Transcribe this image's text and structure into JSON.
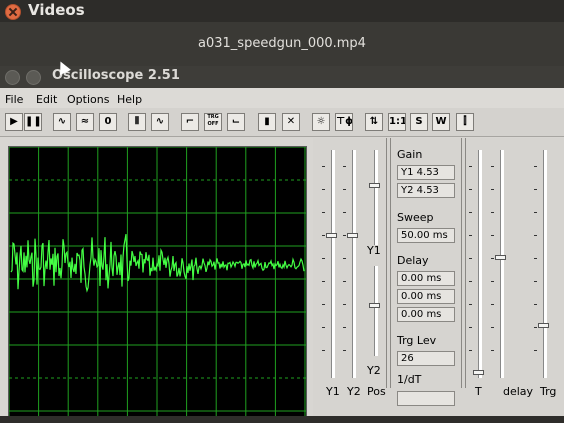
{
  "player": {
    "title": "Videos",
    "filename": "a031_speedgun_000.mp4"
  },
  "scope_window": {
    "title": "Oscilloscope 2.51",
    "menu": [
      "File",
      "Edit",
      "Options",
      "Help"
    ]
  },
  "toolbar_buttons": [
    {
      "name": "play-button",
      "glyph": "▶"
    },
    {
      "name": "pause-button",
      "glyph": "❚❚"
    },
    {
      "name": "sine-wave-button",
      "glyph": "∿"
    },
    {
      "name": "dual-wave-button",
      "glyph": "≈"
    },
    {
      "name": "xy-mode-button",
      "glyph": "0"
    },
    {
      "name": "pulse-wave-button",
      "glyph": "⫴"
    },
    {
      "name": "sine-sweep-button",
      "glyph": "∿"
    },
    {
      "name": "trigger-rise-button",
      "glyph": "⌐"
    },
    {
      "name": "trigger-off-button",
      "glyph": "TRG OFF"
    },
    {
      "name": "trigger-fall-button",
      "glyph": "⌙"
    },
    {
      "name": "spectrum-button",
      "glyph": "▮"
    },
    {
      "name": "cursor-button",
      "glyph": "✕"
    },
    {
      "name": "brightness-button",
      "glyph": "☼"
    },
    {
      "name": "phase-button",
      "glyph": "⊤ϕ"
    },
    {
      "name": "arrows-button",
      "glyph": "⇅"
    },
    {
      "name": "one-to-one-button",
      "glyph": "1:1"
    },
    {
      "name": "s-button",
      "glyph": "S"
    },
    {
      "name": "w-button",
      "glyph": "W"
    },
    {
      "name": "mixer-button",
      "glyph": "⫿"
    }
  ],
  "controls": {
    "gain_label": "Gain",
    "y1_gain": "Y1  4.53",
    "y2_gain": "Y2  4.53",
    "sweep_label": "Sweep",
    "sweep_value": "50.00 ms",
    "delay_label": "Delay",
    "delay_values": [
      "0.00 ms",
      "0.00 ms",
      "0.00 ms"
    ],
    "trg_lev_label": "Trg Lev",
    "trg_lev_value": "26",
    "inv_dt_label": "1/dT",
    "inv_dt_value": "",
    "y1_slider_label": "Y1",
    "y2_slider_label": "Y2",
    "slider_labels": [
      "Y1",
      "Y2",
      "Pos"
    ],
    "right_slider_labels": [
      "T",
      "delay",
      "Trg"
    ]
  },
  "colors": {
    "trace": "#44ff44",
    "grid": "#1fa01f"
  }
}
